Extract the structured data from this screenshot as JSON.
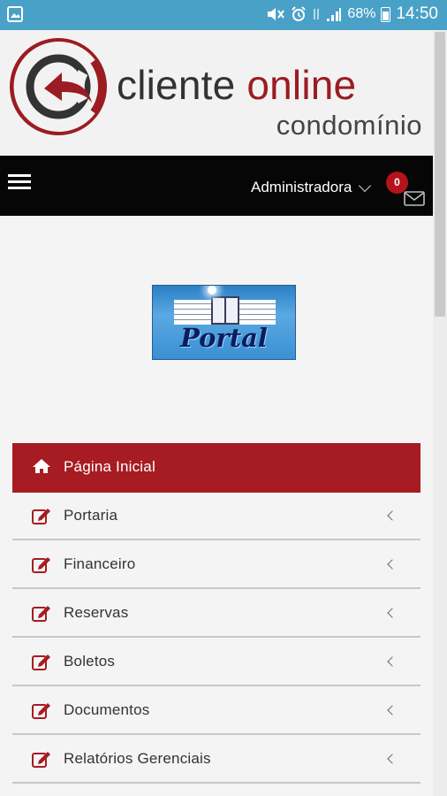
{
  "status_bar": {
    "battery": "68%",
    "time": "14:50"
  },
  "header": {
    "logo_word1": "cliente",
    "logo_word2": "online",
    "logo_sub": "condomínio"
  },
  "navbar": {
    "user_menu_label": "Administradora",
    "notification_count": "0"
  },
  "portal": {
    "logo_text": "Portal"
  },
  "menu": {
    "items": [
      {
        "label": "Página Inicial",
        "icon": "home-icon",
        "active": true
      },
      {
        "label": "Portaria",
        "icon": "edit-icon"
      },
      {
        "label": "Financeiro",
        "icon": "edit-icon"
      },
      {
        "label": "Reservas",
        "icon": "edit-icon"
      },
      {
        "label": "Boletos",
        "icon": "edit-icon"
      },
      {
        "label": "Documentos",
        "icon": "edit-icon"
      },
      {
        "label": "Relatórios Gerenciais",
        "icon": "edit-icon"
      }
    ]
  },
  "colors": {
    "status_bar": "#4aa1c8",
    "brand_red": "#a61c22",
    "navbar": "#060606"
  }
}
